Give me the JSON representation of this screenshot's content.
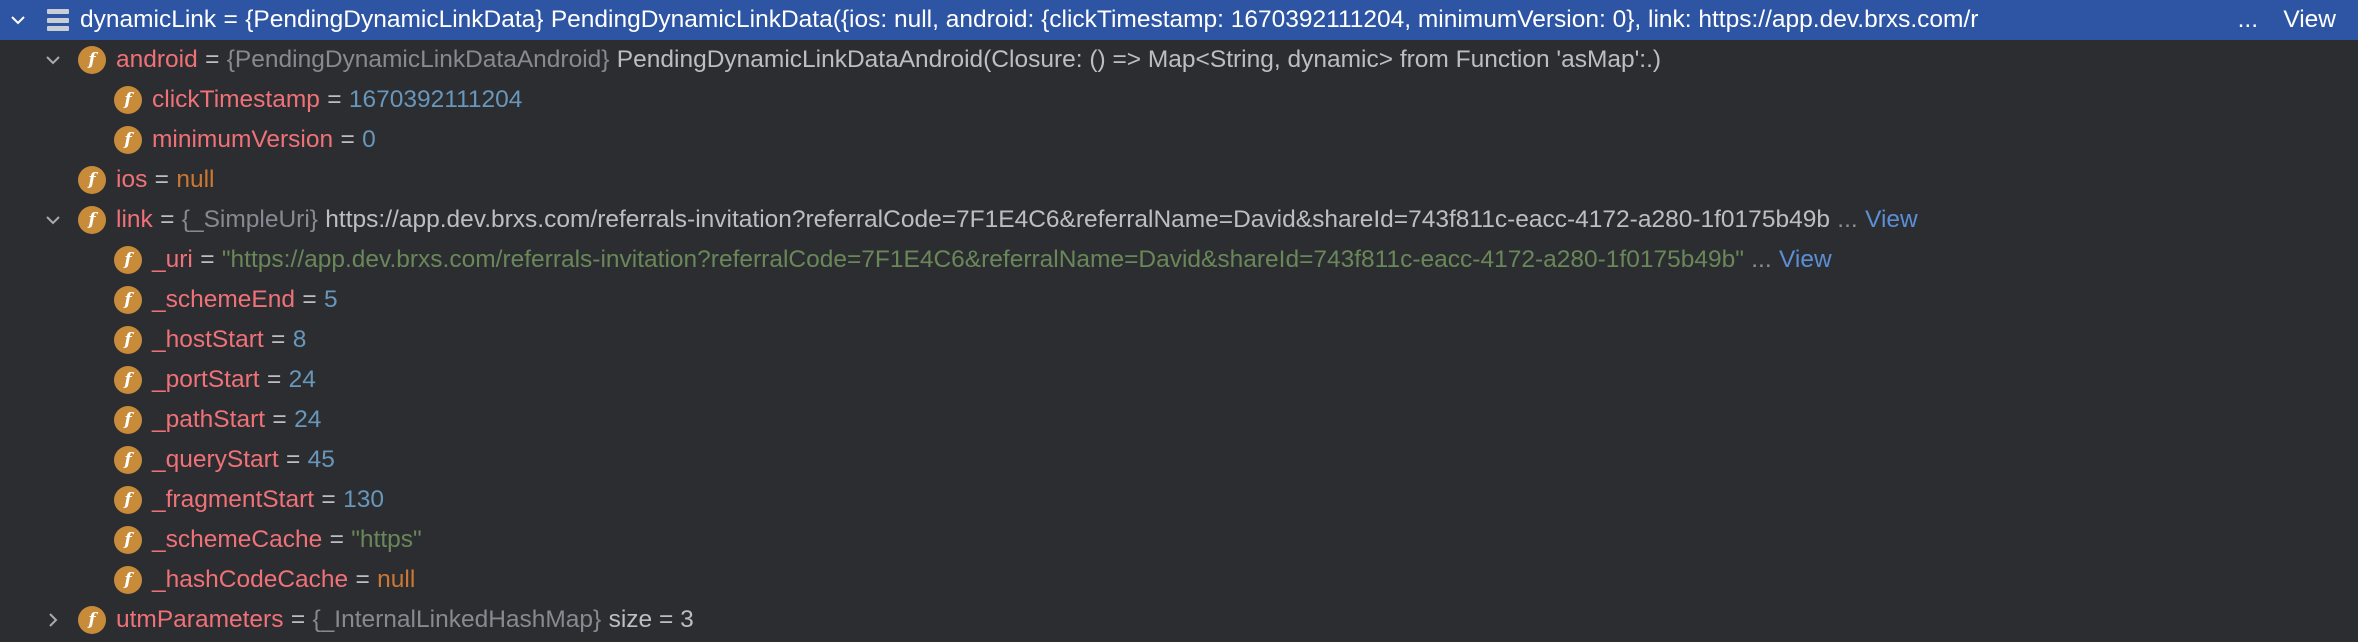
{
  "root": {
    "name": "dynamicLink",
    "type": "{PendingDynamicLinkData}",
    "value": "PendingDynamicLinkData({ios: null, android: {clickTimestamp: 1670392111204, minimumVersion: 0}, link: https://app.dev.brxs.com/r",
    "ellipsis": "...",
    "view": "View"
  },
  "android": {
    "name": "android",
    "type": "{PendingDynamicLinkDataAndroid}",
    "value": "PendingDynamicLinkDataAndroid(Closure: () => Map<String, dynamic> from Function 'asMap':.)",
    "fields": [
      {
        "name": "clickTimestamp",
        "value": "1670392111204"
      },
      {
        "name": "minimumVersion",
        "value": "0"
      }
    ]
  },
  "ios": {
    "name": "ios",
    "value": "null"
  },
  "link": {
    "name": "link",
    "type": "{_SimpleUri}",
    "value": "https://app.dev.brxs.com/referrals-invitation?referralCode=7F1E4C6&referralName=David&shareId=743f811c-eacc-4172-a280-1f0175b49b",
    "ellipsis": "...",
    "view": "View",
    "uri": {
      "name": "_uri",
      "value": "\"https://app.dev.brxs.com/referrals-invitation?referralCode=7F1E4C6&referralName=David&shareId=743f811c-eacc-4172-a280-1f0175b49b\"",
      "ellipsis": "...",
      "view": "View"
    },
    "fields": [
      {
        "name": "_schemeEnd",
        "value": "5"
      },
      {
        "name": "_hostStart",
        "value": "8"
      },
      {
        "name": "_portStart",
        "value": "24"
      },
      {
        "name": "_pathStart",
        "value": "24"
      },
      {
        "name": "_queryStart",
        "value": "45"
      },
      {
        "name": "_fragmentStart",
        "value": "130"
      }
    ],
    "schemeCache": {
      "name": "_schemeCache",
      "value": "\"https\""
    },
    "hashCodeCache": {
      "name": "_hashCodeCache",
      "value": "null"
    }
  },
  "utm": {
    "name": "utmParameters",
    "type": "{_InternalLinkedHashMap}",
    "value": "size = 3"
  },
  "eq": "=",
  "field_icon_letter": "f",
  "colors": {
    "background": "#2b2d30",
    "selection": "#2e55a3",
    "field_name": "#f07178",
    "number": "#6897bb",
    "keyword": "#cc7832",
    "string": "#6a8759",
    "type": "#868a91",
    "link": "#5c8ed6",
    "field_icon": "#c78b3a"
  },
  "icons": {
    "expanded": "chevron-down-icon",
    "collapsed": "chevron-right-icon",
    "root": "list-icon",
    "field": "field-icon"
  }
}
